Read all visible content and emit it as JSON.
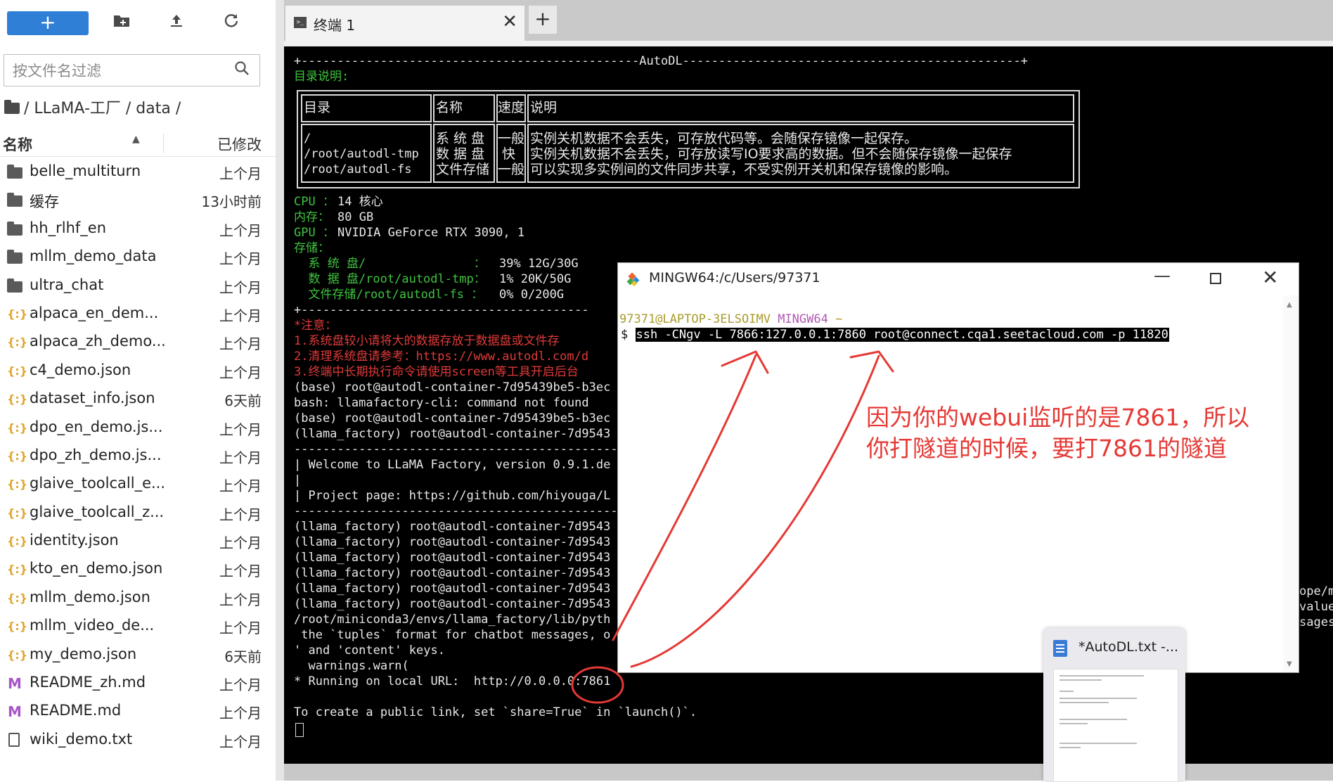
{
  "toolbar": {
    "new_label": "+",
    "icons": [
      "new-folder-icon",
      "upload-icon",
      "refresh-icon"
    ]
  },
  "filter": {
    "placeholder": "按文件名过滤"
  },
  "breadcrumb": {
    "text": "/ LLaMA-工厂 / data /"
  },
  "columns": {
    "name": "名称",
    "modified": "已修改"
  },
  "files": [
    {
      "type": "folder",
      "name": "belle_multiturn",
      "modified": "上个月"
    },
    {
      "type": "folder",
      "name": "缓存",
      "modified": "13小时前"
    },
    {
      "type": "folder",
      "name": "hh_rlhf_en",
      "modified": "上个月"
    },
    {
      "type": "folder",
      "name": "mllm_demo_data",
      "modified": "上个月"
    },
    {
      "type": "folder",
      "name": "ultra_chat",
      "modified": "上个月"
    },
    {
      "type": "json",
      "name": "alpaca_en_dem...",
      "modified": "上个月"
    },
    {
      "type": "json",
      "name": "alpaca_zh_demo...",
      "modified": "上个月"
    },
    {
      "type": "json",
      "name": "c4_demo.json",
      "modified": "上个月"
    },
    {
      "type": "json",
      "name": "dataset_info.json",
      "modified": "6天前"
    },
    {
      "type": "json",
      "name": "dpo_en_demo.js...",
      "modified": "上个月"
    },
    {
      "type": "json",
      "name": "dpo_zh_demo.js...",
      "modified": "上个月"
    },
    {
      "type": "json",
      "name": "glaive_toolcall_e...",
      "modified": "上个月"
    },
    {
      "type": "json",
      "name": "glaive_toolcall_z...",
      "modified": "上个月"
    },
    {
      "type": "json",
      "name": "identity.json",
      "modified": "上个月"
    },
    {
      "type": "json",
      "name": "kto_en_demo.json",
      "modified": "上个月"
    },
    {
      "type": "json",
      "name": "mllm_demo.json",
      "modified": "上个月"
    },
    {
      "type": "json",
      "name": "mllm_video_de...",
      "modified": "上个月"
    },
    {
      "type": "json",
      "name": "my_demo.json",
      "modified": "6天前"
    },
    {
      "type": "md",
      "name": "README_zh.md",
      "modified": "上个月"
    },
    {
      "type": "md",
      "name": "README.md",
      "modified": "上个月"
    },
    {
      "type": "txt",
      "name": "wiki_demo.txt",
      "modified": "上个月"
    }
  ],
  "tab": {
    "label": "终端 1",
    "add": "+",
    "close": "✕",
    "icon": ">_"
  },
  "terminal": {
    "banner": "+-----------------------------------------------AutoDL-----------------------------------------------+",
    "dir_title": "目录说明:",
    "table_header": {
      "dir": "目录",
      "name": "名称",
      "speed": "速度",
      "desc": "说明"
    },
    "table_dirs": "/\n/root/autodl-tmp\n/root/autodl-fs",
    "table_names": "系 统 盘\n数 据 盘\n文件存储",
    "table_speeds": "一般\n 快\n一般",
    "table_descs": "实例关机数据不会丢失，可存放代码等。会随保存镜像一起保存。\n实例关机数据不会丢失，可存放读写IO要求高的数据。但不会随保存镜像一起保存\n可以实现多实例间的文件同步共享，不受实例开关机和保存镜像的影响。",
    "cpu_label": "CPU ：",
    "cpu_value": "14 核心",
    "mem_label": "内存：",
    "mem_value": "80 GB",
    "gpu_label": "GPU ：",
    "gpu_value": "NVIDIA GeForce RTX 3090, 1",
    "storage_label": "存储：",
    "storage_rows": [
      {
        "label": "  系 统 盘/               ：",
        "value": "39% 12G/30G"
      },
      {
        "label": "  数 据 盘/root/autodl-tmp：",
        "value": "1% 20K/50G"
      },
      {
        "label": "  文件存储/root/autodl-fs ：",
        "value": "0% 0/200G"
      }
    ],
    "divider": "+----------------------------------------",
    "notes": [
      "*注意：",
      "1.系统盘较小请将大的数据存放于数据盘或文件存",
      "2.清理系统盘请参考：https://www.autodl.com/d",
      "3.终端中长期执行命令请使用screen等工具开启后台"
    ],
    "lines": [
      "(base) root@autodl-container-7d95439be5-b3ec",
      "bash: llamafactory-cli: command not found",
      "(base) root@autodl-container-7d95439be5-b3ec",
      "(llama_factory) root@autodl-container-7d9543",
      "----------------------------------------------",
      "| Welcome to LLaMA Factory, version 0.9.1.de",
      "|",
      "| Project page: https://github.com/hiyouga/L",
      "----------------------------------------------",
      "(llama_factory) root@autodl-container-7d9543",
      "(llama_factory) root@autodl-container-7d9543",
      "(llama_factory) root@autodl-container-7d9543",
      "(llama_factory) root@autodl-container-7d9543",
      "(llama_factory) root@autodl-container-7d9543",
      "(llama_factory) root@autodl-container-7d9543",
      "/root/miniconda3/envs/llama_factory/lib/pyth",
      " the `tuples` format for chatbot messages, o",
      "' and 'content' keys.",
      "  warnings.warn(",
      "* Running on local URL:  http://0.0.0.0:7861",
      "",
      "To create a public link, set `share=True` in `launch()`."
    ],
    "right_fragments": [
      "ope/m",
      "value",
      "sages"
    ]
  },
  "mingw": {
    "title": "MINGW64:/c/Users/97371",
    "user": "97371@LAPTOP-3ELSOIMV",
    "env": "MINGW64",
    "tilde": "~",
    "prompt": "$",
    "command": "ssh -CNgv -L 7866:127.0.0.1:7860 root@connect.cqa1.seetacloud.com -p 11820"
  },
  "annotation": {
    "line1": "因为你的webui监听的是7861，所以",
    "line2": "你打隧道的时候，要打7861的隧道"
  },
  "taskbar_thumb": {
    "title": "*AutoDL.txt -..."
  },
  "colors": {
    "accent": "#2f7fd6",
    "annotation": "#e53935",
    "term_green": "#3fc43f",
    "term_red": "#e03a3a"
  }
}
